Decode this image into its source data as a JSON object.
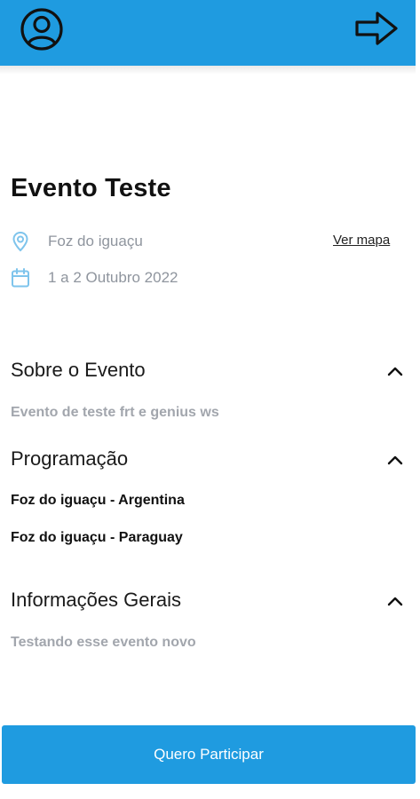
{
  "header": {
    "background_color": "#1f9be0",
    "left_icon": "user-circle-icon",
    "right_icon": "arrow-right-icon"
  },
  "event": {
    "title": "Evento Teste",
    "location": "Foz do iguaçu",
    "location_icon": "map-pin-icon",
    "map_link_label": "Ver mapa",
    "date": "1 a 2 Outubro 2022",
    "date_icon": "calendar-icon",
    "icon_color": "#7ec4ec"
  },
  "sections": [
    {
      "title": "Sobre o Evento",
      "expanded_icon": "chevron-up-icon",
      "content": [
        "Evento de teste frt e genius ws"
      ]
    },
    {
      "title": "Programação",
      "expanded_icon": "chevron-up-icon",
      "content": [
        "Foz do iguaçu - Argentina",
        "Foz do iguaçu - Paraguay"
      ]
    },
    {
      "title": "Informações Gerais",
      "expanded_icon": "chevron-up-icon",
      "content": [
        "Testando esse evento novo"
      ]
    }
  ],
  "cta": {
    "label": "Quero Participar",
    "color": "#1f9be0"
  }
}
